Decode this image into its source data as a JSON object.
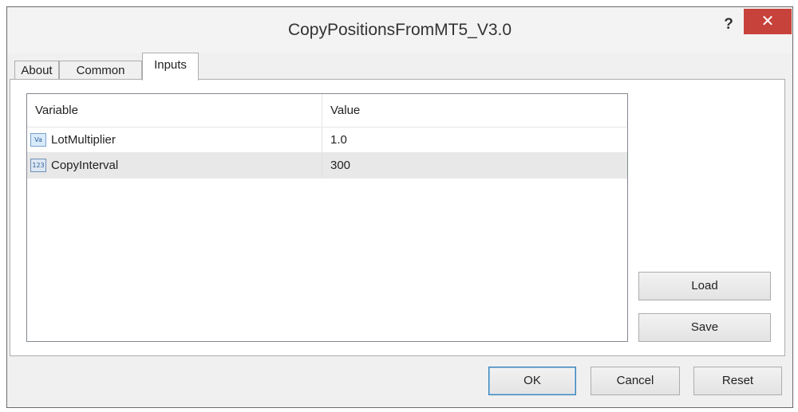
{
  "window": {
    "title": "CopyPositionsFromMT5_V3.0",
    "help": "?",
    "close": "✕"
  },
  "tabs": [
    {
      "label": "About"
    },
    {
      "label": "Common"
    },
    {
      "label": "Inputs"
    }
  ],
  "grid": {
    "columns": [
      "Variable",
      "Value"
    ],
    "rows": [
      {
        "icon": "Va",
        "variable": "LotMultiplier",
        "value": "1.0"
      },
      {
        "icon": "123",
        "variable": "CopyInterval",
        "value": "300"
      }
    ]
  },
  "side_buttons": {
    "load": "Load",
    "save": "Save"
  },
  "footer_buttons": {
    "ok": "OK",
    "cancel": "Cancel",
    "reset": "Reset"
  }
}
